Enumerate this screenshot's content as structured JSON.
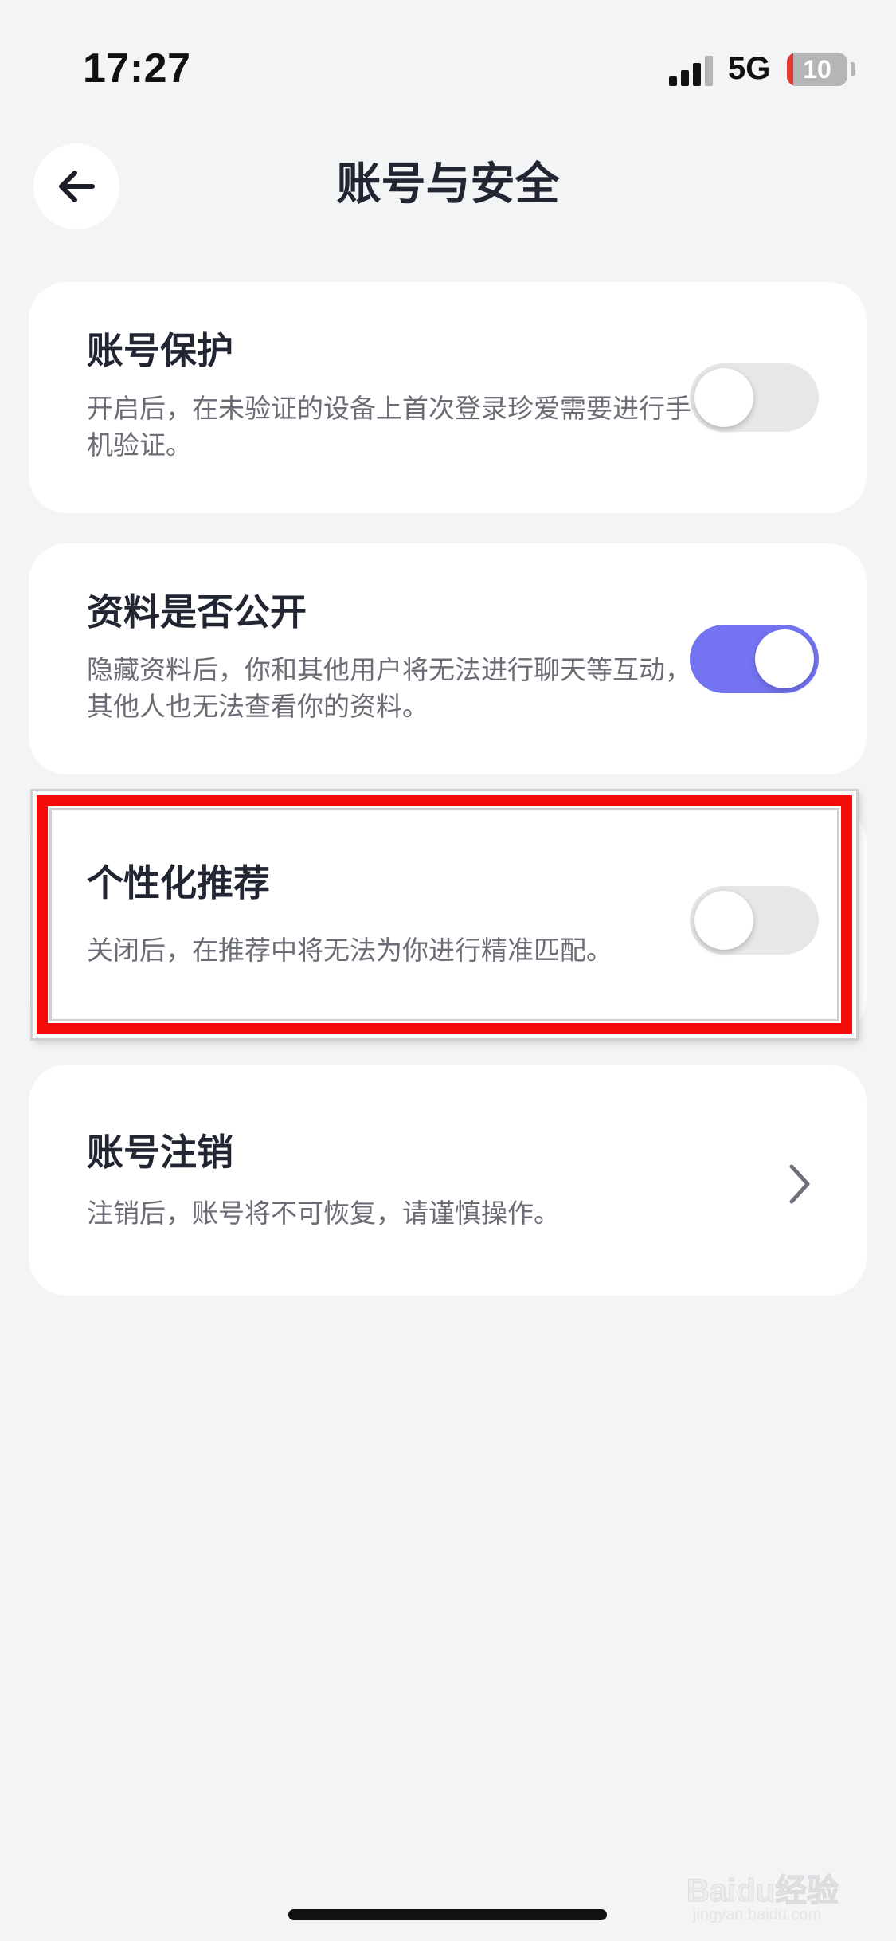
{
  "status_bar": {
    "time": "17:27",
    "network": "5G",
    "battery_level": "10",
    "battery_fraction": 0.1,
    "battery_color": "#e53935",
    "signal_icon": "signal-bars-icon"
  },
  "header": {
    "back_icon": "arrow-left-icon",
    "title": "账号与安全"
  },
  "settings": [
    {
      "title": "账号保护",
      "description": "开启后，在未验证的设备上首次登录珍爱需要进行手机验证。",
      "control": "toggle",
      "enabled": false
    },
    {
      "title": "资料是否公开",
      "description": "隐藏资料后，你和其他用户将无法进行聊天等互动，其他人也无法查看你的资料。",
      "control": "toggle",
      "enabled": true
    },
    {
      "title": "个性化推荐",
      "description": "关闭后，在推荐中将无法为你进行精准匹配。",
      "control": "toggle",
      "enabled": false
    },
    {
      "title": "账号注销",
      "description": "注销后，账号将不可恢复，请谨慎操作。",
      "control": "chevron",
      "icon": "chevron-right-icon"
    }
  ],
  "colors": {
    "toggle_on": "#7474f2",
    "toggle_off": "#e7e7ea",
    "highlight": "#f50a0a",
    "background": "#f3f4f6"
  },
  "watermark": {
    "text": "Baidu经验",
    "sub": "jingyan.baidu.com"
  }
}
